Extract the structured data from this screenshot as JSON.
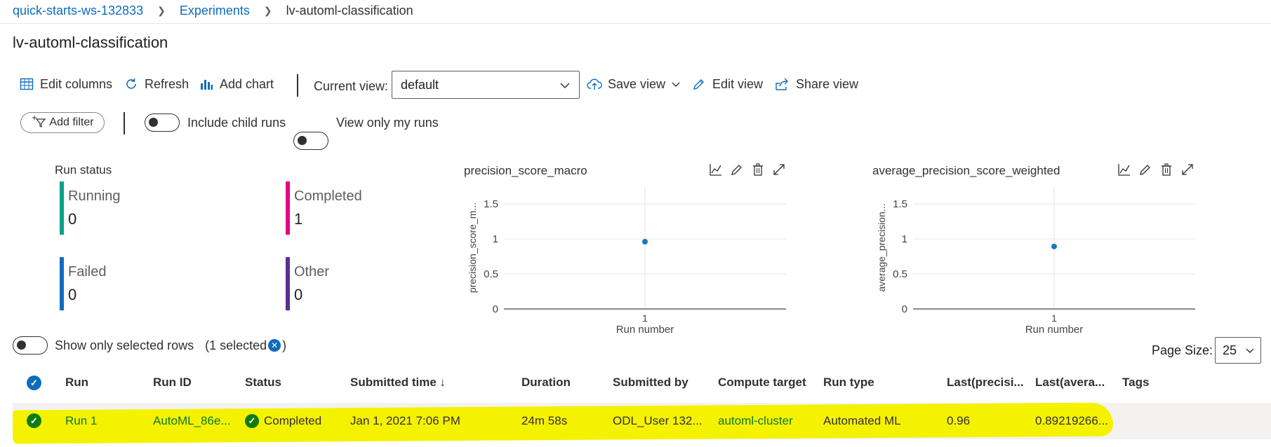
{
  "breadcrumb": {
    "workspace": "quick-starts-ws-132833",
    "experiments": "Experiments",
    "current": "lv-automl-classification"
  },
  "page_title": "lv-automl-classification",
  "toolbar": {
    "edit_columns": "Edit columns",
    "refresh": "Refresh",
    "add_chart": "Add chart",
    "current_view_label": "Current view:",
    "current_view_value": "default",
    "save_view": "Save view",
    "edit_view": "Edit view",
    "share_view": "Share view"
  },
  "filters": {
    "add_filter": "Add filter",
    "include_child_runs": "Include child runs",
    "include_child_runs_on": false,
    "view_only_my_runs": "View only my runs",
    "view_only_my_runs_on": false
  },
  "run_status": {
    "title": "Run status",
    "cards": [
      {
        "label": "Running",
        "value": "0",
        "color": "#00a488"
      },
      {
        "label": "Completed",
        "value": "1",
        "color": "#e3008c"
      },
      {
        "label": "Failed",
        "value": "0",
        "color": "#0f6cbd"
      },
      {
        "label": "Other",
        "value": "0",
        "color": "#5c2e91"
      }
    ]
  },
  "chart_data": [
    {
      "type": "scatter",
      "title": "precision_score_macro",
      "xlabel": "Run number",
      "ylabel": "precision_score_m...",
      "x": [
        1
      ],
      "y": [
        0.96
      ],
      "x_ticks": [
        "1"
      ],
      "y_ticks": [
        "0",
        "0.5",
        "1",
        "1.5"
      ],
      "ylim": [
        0,
        1.75
      ],
      "grid": true,
      "point_color": "#1f77b4"
    },
    {
      "type": "scatter",
      "title": "average_precision_score_weighted",
      "xlabel": "Run number",
      "ylabel": "average_precision...",
      "x": [
        1
      ],
      "y": [
        0.892
      ],
      "x_ticks": [
        "1"
      ],
      "y_ticks": [
        "0",
        "0.5",
        "1",
        "1.5"
      ],
      "ylim": [
        0,
        1.75
      ],
      "grid": true,
      "point_color": "#1f77b4"
    }
  ],
  "selection": {
    "show_only_selected": "Show only selected rows",
    "show_only_selected_on": false,
    "selected_open": "(1 selected",
    "selected_close": ")"
  },
  "page_size": {
    "label": "Page Size:",
    "value": "25"
  },
  "table": {
    "headers": [
      "Run",
      "Run ID",
      "Status",
      "Submitted time ↓",
      "Duration",
      "Submitted by",
      "Compute target",
      "Run type",
      "Last(precisi...",
      "Last(avera...",
      "Tags"
    ],
    "rows": [
      {
        "run": "Run 1",
        "run_id": "AutoML_86e...",
        "status": "Completed",
        "submitted_time": "Jan 1, 2021 7:06 PM",
        "duration": "24m 58s",
        "submitted_by": "ODL_User 132...",
        "compute_target": "automl-cluster",
        "run_type": "Automated ML",
        "last_precision": "0.96",
        "last_average": "0.89219266...",
        "tags": ""
      }
    ]
  },
  "colors": {
    "accent": "#0f6cbd",
    "success": "#107c10",
    "highlight": "#f5f200"
  }
}
